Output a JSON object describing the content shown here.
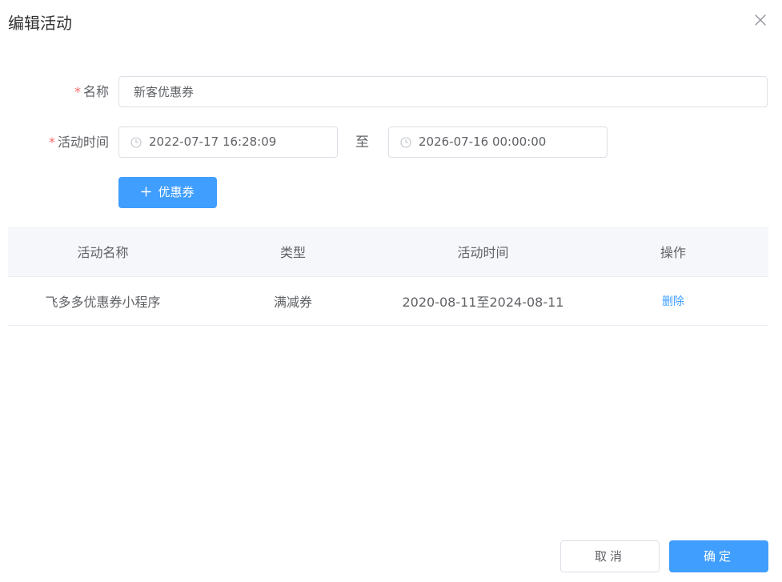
{
  "dialog": {
    "title": "编辑活动",
    "close_icon": "close-icon"
  },
  "form": {
    "name": {
      "required_mark": "*",
      "label": "名称",
      "value": "新客优惠券"
    },
    "time": {
      "required_mark": "*",
      "label": "活动时间",
      "start": "2022-07-17 16:28:09",
      "separator": "至",
      "end": "2026-07-16 00:00:00",
      "icon": "clock-icon"
    },
    "add_coupon": {
      "icon": "plus-icon",
      "label": "优惠券"
    }
  },
  "table": {
    "headers": [
      "活动名称",
      "类型",
      "活动时间",
      "操作"
    ],
    "rows": [
      {
        "name": "飞多多优惠券小程序",
        "type": "满减券",
        "time": "2020-08-11至2024-08-11",
        "action": "删除"
      }
    ]
  },
  "footer": {
    "cancel_label": "取消",
    "ok_label": "确定"
  },
  "colors": {
    "primary": "#409eff",
    "required": "#f56c6c",
    "header_bg": "#f5f7fa"
  }
}
